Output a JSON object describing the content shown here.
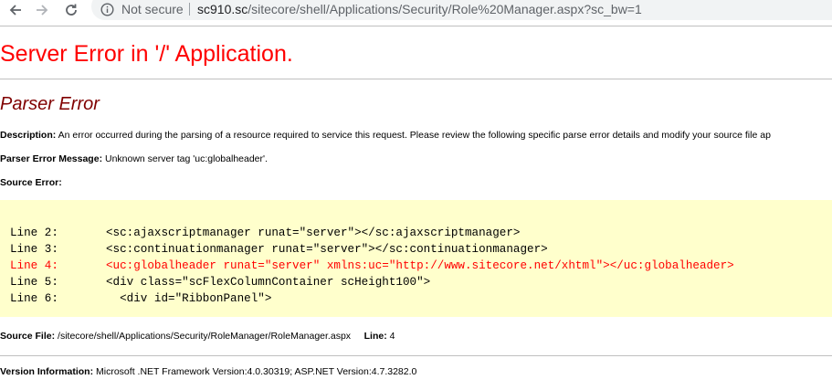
{
  "browser": {
    "security_label": "Not secure",
    "url_host": "sc910.sc",
    "url_path": "/sitecore/shell/Applications/Security/Role%20Manager.aspx?sc_bw=1"
  },
  "error_page": {
    "title": "Server Error in '/' Application.",
    "subtitle": "Parser Error",
    "description_label": "Description:",
    "description_text": "An error occurred during the parsing of a resource required to service this request. Please review the following specific parse error details and modify your source file ap",
    "parser_msg_label": "Parser Error Message:",
    "parser_msg_text": "Unknown server tag 'uc:globalheader'.",
    "source_error_label": "Source Error:",
    "code_lines": [
      {
        "line": "Line 2:",
        "code": "<sc:ajaxscriptmanager runat=\"server\"></sc:ajaxscriptmanager>"
      },
      {
        "line": "Line 3:",
        "code": "<sc:continuationmanager runat=\"server\"></sc:continuationmanager>"
      },
      {
        "line": "Line 4:",
        "code": "<uc:globalheader runat=\"server\" xmlns:uc=\"http://www.sitecore.net/xhtml\"></uc:globalheader>"
      },
      {
        "line": "Line 5:",
        "code": "<div class=\"scFlexColumnContainer scHeight100\">"
      },
      {
        "line": "Line 6:",
        "code": "  <div id=\"RibbonPanel\">"
      }
    ],
    "source_file_label": "Source File:",
    "source_file_value": "/sitecore/shell/Applications/Security/RoleManager/RoleManager.aspx",
    "line_label": "Line:",
    "line_value": "4",
    "version_label": "Version Information:",
    "version_value": "Microsoft .NET Framework Version:4.0.30319; ASP.NET Version:4.7.3282.0"
  },
  "colors": {
    "title": "#ff0000",
    "subtitle": "#800000",
    "code_bg": "#ffffcc",
    "error_line": "#ff0000"
  }
}
